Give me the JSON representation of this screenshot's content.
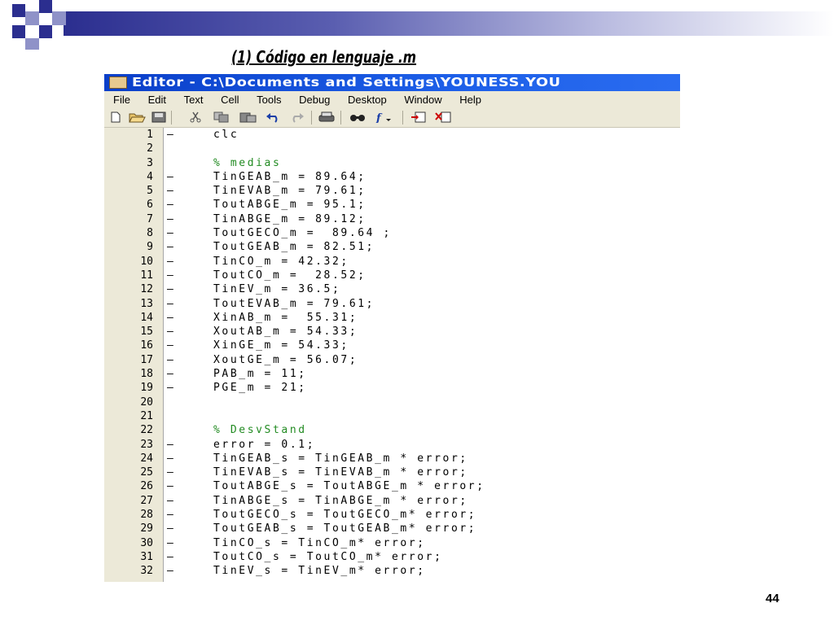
{
  "slide": {
    "title": "(1) Código en lenguaje .m",
    "page_number": "44"
  },
  "window": {
    "title": "Editor - C:\\Documents and Settings\\YOUNESS.YOU"
  },
  "menu": [
    "File",
    "Edit",
    "Text",
    "Cell",
    "Tools",
    "Debug",
    "Desktop",
    "Window",
    "Help"
  ],
  "toolbar_icons": [
    "new-file-icon",
    "open-folder-icon",
    "save-icon",
    "cut-icon",
    "copy-icon",
    "paste-icon",
    "undo-icon",
    "redo-icon",
    "print-icon",
    "find-icon",
    "function-icon",
    "insert-icon",
    "delete-icon"
  ],
  "colors": {
    "comment": "#228b22",
    "titlebar": "#0a3fc9",
    "slide_accent": "#2b2e8f"
  },
  "code_lines": [
    {
      "n": "1",
      "m": "–",
      "t": "clc"
    },
    {
      "n": "2",
      "m": "",
      "t": ""
    },
    {
      "n": "3",
      "m": "",
      "t": "% medias",
      "c": true
    },
    {
      "n": "4",
      "m": "–",
      "t": "TinGEAB_m = 89.64;"
    },
    {
      "n": "5",
      "m": "–",
      "t": "TinEVAB_m = 79.61;"
    },
    {
      "n": "6",
      "m": "–",
      "t": "ToutABGE_m = 95.1;"
    },
    {
      "n": "7",
      "m": "–",
      "t": "TinABGE_m = 89.12;"
    },
    {
      "n": "8",
      "m": "–",
      "t": "ToutGECO_m =  89.64 ;"
    },
    {
      "n": "9",
      "m": "–",
      "t": "ToutGEAB_m = 82.51;"
    },
    {
      "n": "10",
      "m": "–",
      "t": "TinCO_m = 42.32;"
    },
    {
      "n": "11",
      "m": "–",
      "t": "ToutCO_m =  28.52;"
    },
    {
      "n": "12",
      "m": "–",
      "t": "TinEV_m = 36.5;"
    },
    {
      "n": "13",
      "m": "–",
      "t": "ToutEVAB_m = 79.61;"
    },
    {
      "n": "14",
      "m": "–",
      "t": "XinAB_m =  55.31;"
    },
    {
      "n": "15",
      "m": "–",
      "t": "XoutAB_m = 54.33;"
    },
    {
      "n": "16",
      "m": "–",
      "t": "XinGE_m = 54.33;"
    },
    {
      "n": "17",
      "m": "–",
      "t": "XoutGE_m = 56.07;"
    },
    {
      "n": "18",
      "m": "–",
      "t": "PAB_m = 11;"
    },
    {
      "n": "19",
      "m": "–",
      "t": "PGE_m = 21;"
    },
    {
      "n": "20",
      "m": "",
      "t": ""
    },
    {
      "n": "21",
      "m": "",
      "t": ""
    },
    {
      "n": "22",
      "m": "",
      "t": "% DesvStand",
      "c": true
    },
    {
      "n": "23",
      "m": "–",
      "t": "error = 0.1;"
    },
    {
      "n": "24",
      "m": "–",
      "t": "TinGEAB_s = TinGEAB_m * error;"
    },
    {
      "n": "25",
      "m": "–",
      "t": "TinEVAB_s = TinEVAB_m * error;"
    },
    {
      "n": "26",
      "m": "–",
      "t": "ToutABGE_s = ToutABGE_m * error;"
    },
    {
      "n": "27",
      "m": "–",
      "t": "TinABGE_s = TinABGE_m * error;"
    },
    {
      "n": "28",
      "m": "–",
      "t": "ToutGECO_s = ToutGECO_m* error;"
    },
    {
      "n": "29",
      "m": "–",
      "t": "ToutGEAB_s = ToutGEAB_m* error;"
    },
    {
      "n": "30",
      "m": "–",
      "t": "TinCO_s = TinCO_m* error;"
    },
    {
      "n": "31",
      "m": "–",
      "t": "ToutCO_s = ToutCO_m* error;"
    },
    {
      "n": "32",
      "m": "–",
      "t": "TinEV_s = TinEV_m* error;"
    }
  ]
}
